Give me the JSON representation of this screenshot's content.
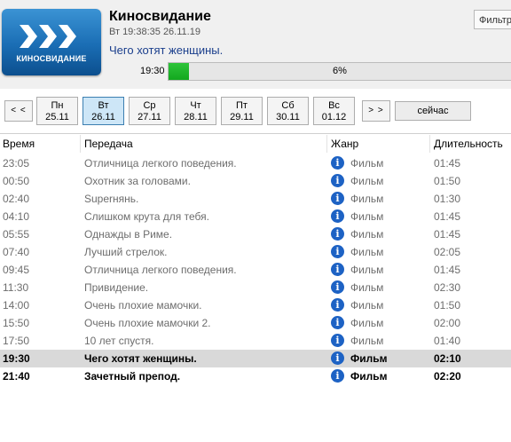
{
  "header": {
    "logo_text": "КИНОСВИДАНИЕ",
    "app_title": "Киносвидание",
    "datetime": "Вт 19:38:35 26.11.19",
    "current_program": "Чего хотят женщины.",
    "filter_label": "Фильтр"
  },
  "progress": {
    "start_time": "19:30",
    "percent_label": "6%",
    "fraction": 0.06
  },
  "days": {
    "prev_label": "< <",
    "next_label": "> >",
    "now_label": "сейчас",
    "items": [
      {
        "day": "Пн",
        "date": "25.11"
      },
      {
        "day": "Вт",
        "date": "26.11"
      },
      {
        "day": "Ср",
        "date": "27.11"
      },
      {
        "day": "Чт",
        "date": "28.11"
      },
      {
        "day": "Пт",
        "date": "29.11"
      },
      {
        "day": "Сб",
        "date": "30.11"
      },
      {
        "day": "Вс",
        "date": "01.12"
      }
    ],
    "active_index": 1
  },
  "table": {
    "headers": {
      "time": "Время",
      "program": "Передача",
      "genre": "Жанр",
      "duration": "Длительность"
    },
    "rows": [
      {
        "time": "23:05",
        "program": "Отличница легкого поведения.",
        "genre": "Фильм",
        "duration": "01:45",
        "state": "past"
      },
      {
        "time": "00:50",
        "program": "Охотник за головами.",
        "genre": "Фильм",
        "duration": "01:50",
        "state": "past"
      },
      {
        "time": "02:40",
        "program": "Superнянь.",
        "genre": "Фильм",
        "duration": "01:30",
        "state": "past"
      },
      {
        "time": "04:10",
        "program": "Слишком крута для тебя.",
        "genre": "Фильм",
        "duration": "01:45",
        "state": "past"
      },
      {
        "time": "05:55",
        "program": "Однажды в Риме.",
        "genre": "Фильм",
        "duration": "01:45",
        "state": "past"
      },
      {
        "time": "07:40",
        "program": "Лучший стрелок.",
        "genre": "Фильм",
        "duration": "02:05",
        "state": "past"
      },
      {
        "time": "09:45",
        "program": "Отличница легкого поведения.",
        "genre": "Фильм",
        "duration": "01:45",
        "state": "past"
      },
      {
        "time": "11:30",
        "program": "Привидение.",
        "genre": "Фильм",
        "duration": "02:30",
        "state": "past"
      },
      {
        "time": "14:00",
        "program": "Очень плохие мамочки.",
        "genre": "Фильм",
        "duration": "01:50",
        "state": "past"
      },
      {
        "time": "15:50",
        "program": "Очень плохие мамочки 2.",
        "genre": "Фильм",
        "duration": "02:00",
        "state": "past"
      },
      {
        "time": "17:50",
        "program": "10 лет спустя.",
        "genre": "Фильм",
        "duration": "01:40",
        "state": "past"
      },
      {
        "time": "19:30",
        "program": "Чего хотят женщины.",
        "genre": "Фильм",
        "duration": "02:10",
        "state": "current"
      },
      {
        "time": "21:40",
        "program": "Зачетный препод.",
        "genre": "Фильм",
        "duration": "02:20",
        "state": "future"
      }
    ],
    "info_glyph": "i"
  }
}
